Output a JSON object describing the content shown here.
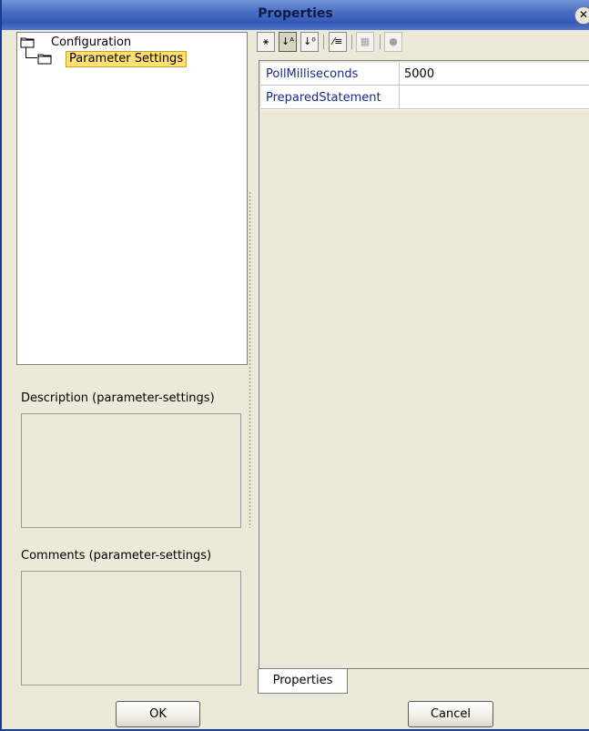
{
  "window": {
    "title": "Properties"
  },
  "tree": {
    "root_label": "Configuration",
    "child_label": "Parameter Settings"
  },
  "description": {
    "label": "Description (parameter-settings)",
    "value": ""
  },
  "comments": {
    "label": "Comments (parameter-settings)",
    "value": ""
  },
  "toolbar": {
    "buttons": [
      "sort-categorized-icon",
      "sort-alphabetical-icon",
      "sort-by-icon",
      "show-modified-icon",
      "description-toggle-icon",
      "help-icon"
    ]
  },
  "properties": {
    "rows": [
      {
        "name": "PollMilliseconds",
        "value": "5000"
      },
      {
        "name": "PreparedStatement",
        "value": ""
      }
    ],
    "tab_label": "Properties"
  },
  "buttons": {
    "ok": "OK",
    "cancel": "Cancel"
  }
}
